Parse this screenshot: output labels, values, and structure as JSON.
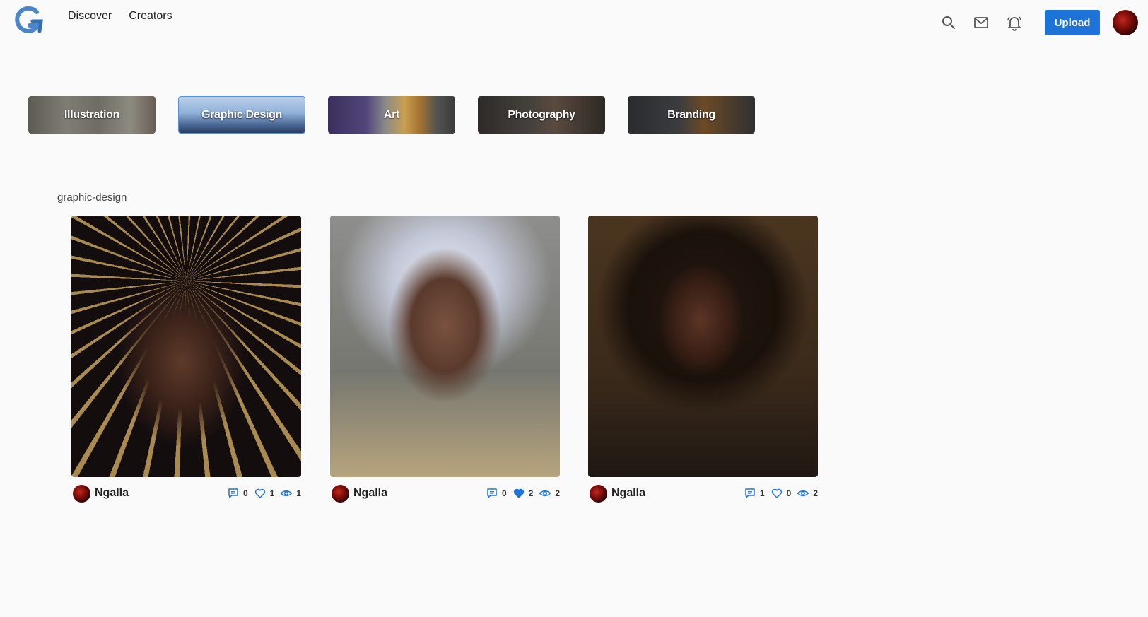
{
  "header": {
    "logo_icon": "brand-logo-icon",
    "nav": [
      "Discover",
      "Creators"
    ],
    "icons": [
      "search-icon",
      "mail-icon",
      "bell-icon"
    ],
    "upload_label": "Upload",
    "accent_color": "#1e73d8"
  },
  "categories": [
    {
      "label": "Illustration",
      "selected": false
    },
    {
      "label": "Graphic Design",
      "selected": true
    },
    {
      "label": "Art",
      "selected": false
    },
    {
      "label": "Photography",
      "selected": false
    },
    {
      "label": "Branding",
      "selected": false
    }
  ],
  "section": {
    "label": "graphic-design"
  },
  "cards": [
    {
      "author": "Ngalla",
      "comments": "0",
      "likes": "1",
      "liked": false,
      "views": "1"
    },
    {
      "author": "Ngalla",
      "comments": "0",
      "likes": "2",
      "liked": true,
      "views": "2"
    },
    {
      "author": "Ngalla",
      "comments": "1",
      "likes": "0",
      "liked": false,
      "views": "2"
    }
  ]
}
